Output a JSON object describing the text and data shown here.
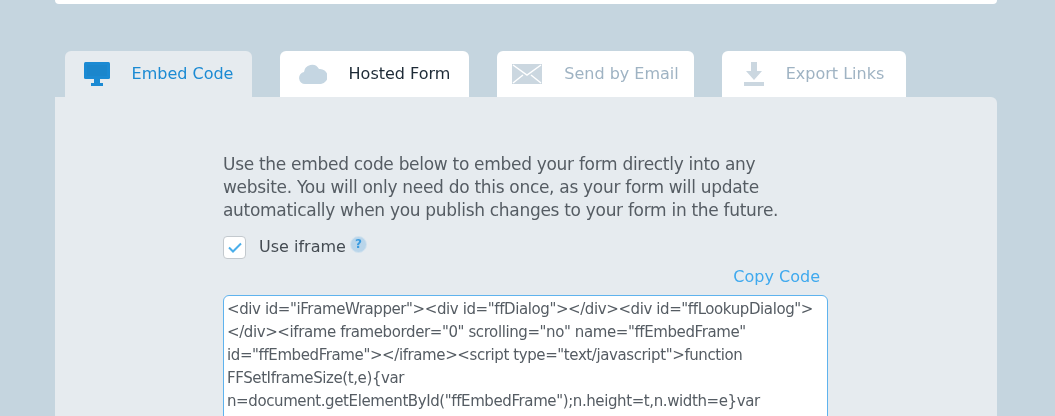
{
  "tabs": [
    {
      "label": "Embed Code",
      "selected": true,
      "disabled": false
    },
    {
      "label": "Hosted Form",
      "selected": false,
      "disabled": false
    },
    {
      "label": "Send by Email",
      "selected": false,
      "disabled": true
    },
    {
      "label": "Export Links",
      "selected": false,
      "disabled": true
    }
  ],
  "description": "Use the embed code below to embed your form directly into any website. You will only need do this once, as your form will update automatically when you publish changes to your form in the future.",
  "use_iframe": {
    "label": "Use iframe",
    "checked": true,
    "help": "?"
  },
  "copy_link": "Copy Code",
  "code_lines": [
    "<div id=\"iFrameWrapper\"><div id=\"ffDialog\"></div><div id=\"ffLookupDialog\">",
    "</div><iframe frameborder=\"0\" scrolling=\"no\" name=\"ffEmbedFrame\"",
    "id=\"ffEmbedFrame\"></iframe><script type=\"text/javascript\">function",
    "FFSetIframeSize(t,e){var",
    "n=document.getElementById(\"ffEmbedFrame\");n.height=t,n.width=e}var"
  ]
}
